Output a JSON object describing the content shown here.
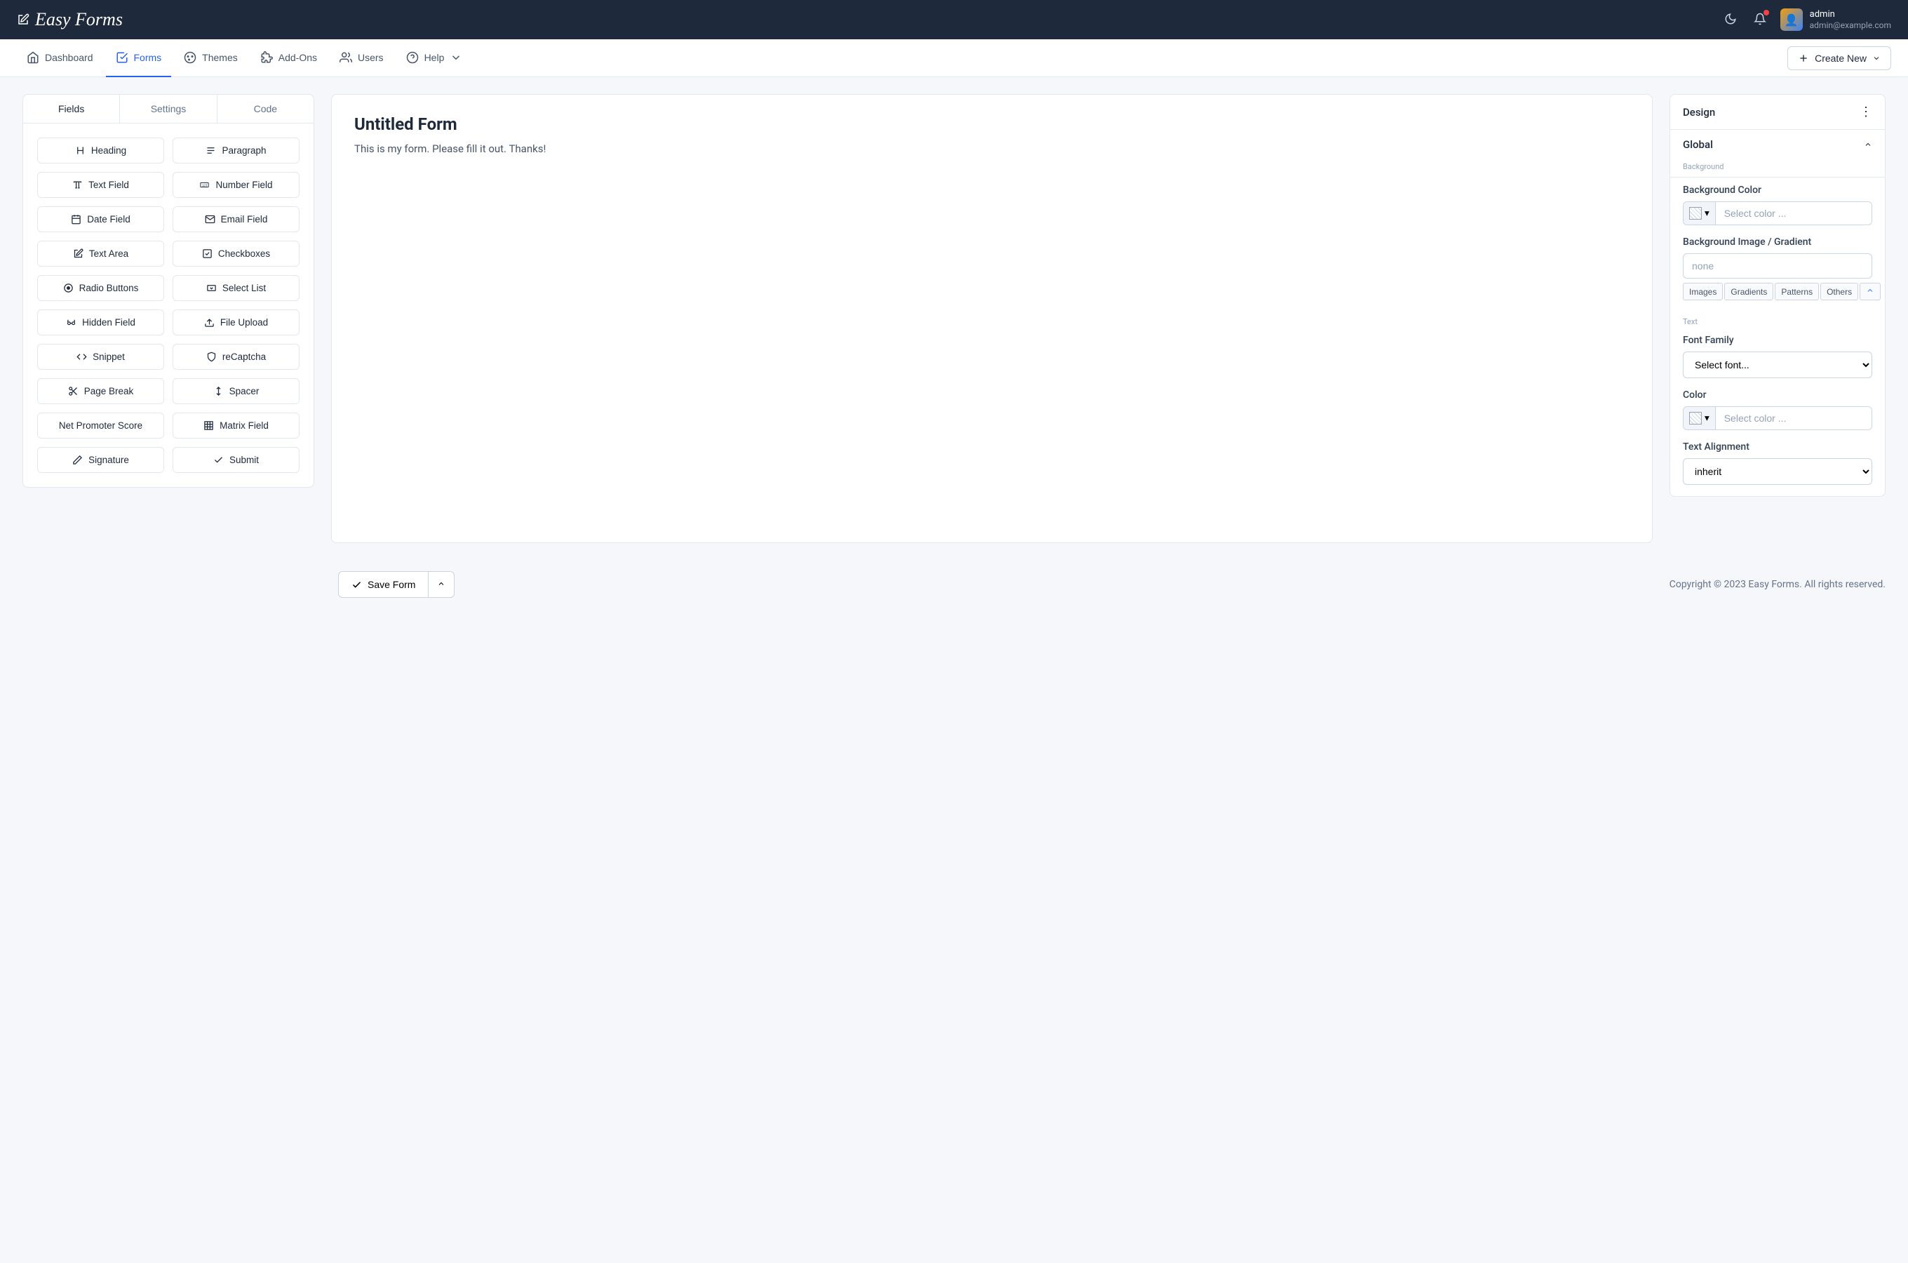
{
  "brand": "Easy Forms",
  "user": {
    "name": "admin",
    "email": "admin@example.com"
  },
  "nav": {
    "dashboard": "Dashboard",
    "forms": "Forms",
    "themes": "Themes",
    "addons": "Add-Ons",
    "users": "Users",
    "help": "Help",
    "create_new": "Create New"
  },
  "builder_tabs": {
    "fields": "Fields",
    "settings": "Settings",
    "code": "Code"
  },
  "fields": {
    "heading": "Heading",
    "paragraph": "Paragraph",
    "text_field": "Text Field",
    "number_field": "Number Field",
    "date_field": "Date Field",
    "email_field": "Email Field",
    "text_area": "Text Area",
    "checkboxes": "Checkboxes",
    "radio_buttons": "Radio Buttons",
    "select_list": "Select List",
    "hidden_field": "Hidden Field",
    "file_upload": "File Upload",
    "snippet": "Snippet",
    "recaptcha": "reCaptcha",
    "page_break": "Page Break",
    "spacer": "Spacer",
    "nps": "Net Promoter Score",
    "matrix": "Matrix Field",
    "signature": "Signature",
    "submit": "Submit"
  },
  "form": {
    "title": "Untitled Form",
    "description": "This is my form. Please fill it out. Thanks!"
  },
  "design": {
    "title": "Design",
    "section_global": "Global",
    "sub_background": "Background",
    "bg_color_label": "Background Color",
    "bg_color_placeholder": "Select color ...",
    "bg_image_label": "Background Image / Gradient",
    "bg_image_placeholder": "none",
    "chip_images": "Images",
    "chip_gradients": "Gradients",
    "chip_patterns": "Patterns",
    "chip_others": "Others",
    "sub_text": "Text",
    "font_family_label": "Font Family",
    "font_family_placeholder": "Select font...",
    "color_label": "Color",
    "color_placeholder": "Select color ...",
    "alignment_label": "Text Alignment",
    "alignment_value": "inherit"
  },
  "actions": {
    "save_form": "Save Form"
  },
  "footer": {
    "copyright": "Copyright © 2023 Easy Forms. All rights reserved."
  }
}
